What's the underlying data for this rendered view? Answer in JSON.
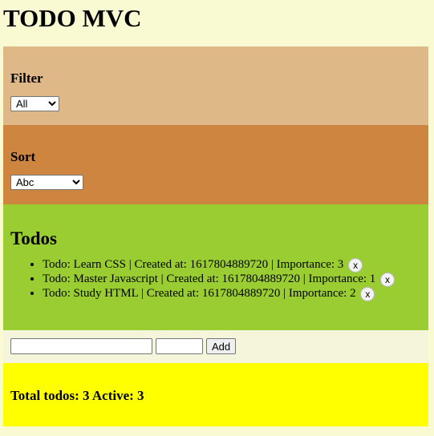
{
  "app": {
    "title": "TODO MVC"
  },
  "filter": {
    "heading": "Filter",
    "selected": "All"
  },
  "sort": {
    "heading": "Sort",
    "selected": "Abc"
  },
  "todos": {
    "heading": "Todos",
    "items": [
      {
        "text": "Todo: Learn CSS | Created at: 1617804889720 | Importance: 3",
        "remove_label": "x"
      },
      {
        "text": "Todo: Master Javascript | Created at: 1617804889720 | Importance: 1",
        "remove_label": "x"
      },
      {
        "text": "Todo: Study HTML | Created at: 1617804889720 | Importance: 2",
        "remove_label": "x"
      }
    ]
  },
  "add_form": {
    "todo_value": "",
    "importance_value": "",
    "add_label": "Add"
  },
  "totals": {
    "text": "Total todos: 3 Active: 3"
  },
  "colors": {
    "page_bg": "#fafad2",
    "filter_bg": "#deb887",
    "sort_bg": "#cd853f",
    "todos_bg": "#9acd32",
    "add_bg": "#f5f5dc",
    "totals_bg": "#ffff00"
  }
}
